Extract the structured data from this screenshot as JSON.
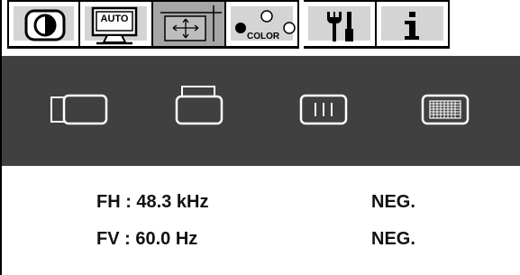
{
  "tabs": [
    {
      "name": "contrast-brightness",
      "icon": "contrast-icon"
    },
    {
      "name": "auto-adjust",
      "icon": "auto-monitor-icon",
      "label": "AUTO"
    },
    {
      "name": "position",
      "icon": "position-arrows-icon",
      "active": true
    },
    {
      "name": "color",
      "icon": "color-dots-icon",
      "label": "COLOR"
    },
    {
      "name": "tools",
      "icon": "tools-icon"
    },
    {
      "name": "information",
      "icon": "info-icon"
    }
  ],
  "submenu": {
    "icons": [
      "horizontal-position-icon",
      "vertical-position-icon",
      "clock-icon",
      "phase-icon"
    ]
  },
  "info": {
    "fh_label": "FH : 48.3 kHz",
    "fh_polarity": "NEG.",
    "fv_label": "FV : 60.0 Hz",
    "fv_polarity": "NEG."
  },
  "colors": {
    "active_tab": "#a6a6a6",
    "inactive_tab": "#d4d4d4",
    "submenu_bg": "#404040"
  }
}
